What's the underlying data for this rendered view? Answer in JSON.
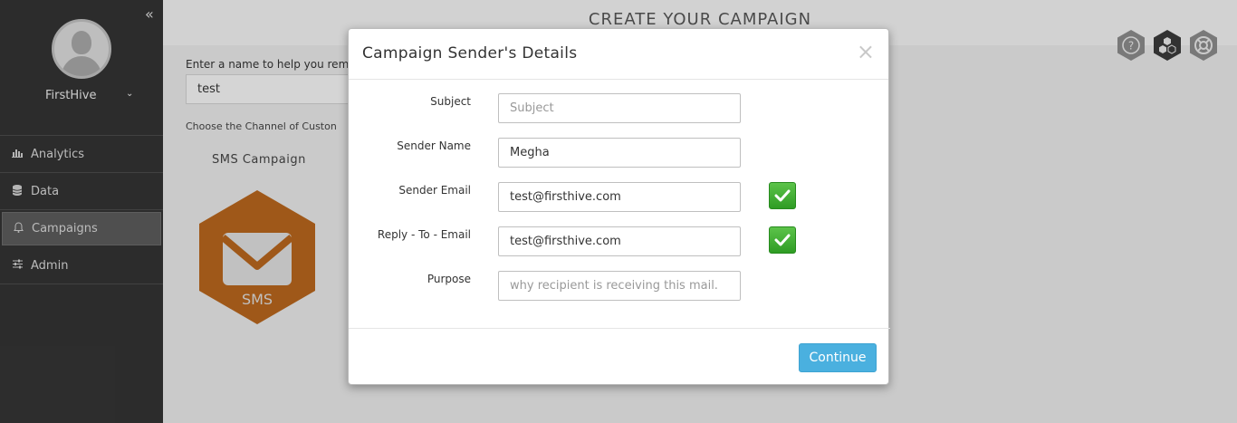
{
  "sidebar": {
    "username": "FirstHive",
    "items": [
      {
        "label": "Analytics",
        "icon": "bar-chart-icon"
      },
      {
        "label": "Data",
        "icon": "database-icon"
      },
      {
        "label": "Campaigns",
        "icon": "bell-icon",
        "active": true
      },
      {
        "label": "Admin",
        "icon": "sliders-icon"
      }
    ]
  },
  "main": {
    "page_title": "CREATE YOUR CAMPAIGN",
    "name_label": "Enter a name to help you reme",
    "name_value": "test",
    "channel_label": "Choose the Channel of Custon",
    "sms_title": "SMS Campaign",
    "sms_badge": "SMS"
  },
  "modal": {
    "title": "Campaign Sender's Details",
    "close": "×",
    "fields": {
      "subject": {
        "label": "Subject",
        "value": "",
        "placeholder": "Subject"
      },
      "sender_name": {
        "label": "Sender Name",
        "value": "Megha",
        "placeholder": ""
      },
      "sender_email": {
        "label": "Sender Email",
        "value": "test@firsthive.com",
        "placeholder": "",
        "verified": true
      },
      "reply_to": {
        "label": "Reply - To - Email",
        "value": "test@firsthive.com",
        "placeholder": "",
        "verified": true
      },
      "purpose": {
        "label": "Purpose",
        "value": "",
        "placeholder": "why recipient is receiving this mail."
      }
    },
    "continue_label": "Continue"
  },
  "colors": {
    "sidebar_bg": "#333333",
    "accent_orange": "#b5651d",
    "button_blue": "#4ab0df",
    "check_green": "#3aa82c"
  }
}
